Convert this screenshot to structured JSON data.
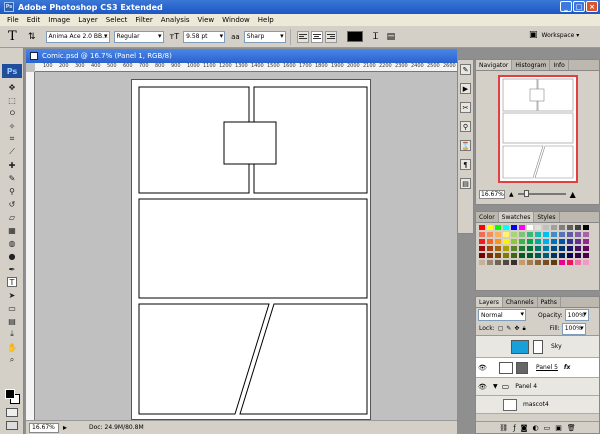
{
  "window": {
    "title": "Adobe Photoshop CS3 Extended",
    "app_icon": "Ps"
  },
  "menu": [
    "File",
    "Edit",
    "Image",
    "Layer",
    "Select",
    "Filter",
    "Analysis",
    "View",
    "Window",
    "Help"
  ],
  "options": {
    "font_family": "Anima Ace 2.0 BB...",
    "font_style": "Regular",
    "font_size": "9.58 pt",
    "anti_alias": "Sharp",
    "color": "#000000",
    "workspace_label": "Workspace ▾"
  },
  "toolbox": {
    "logo": "Ps"
  },
  "document": {
    "title": "Comic.psd @ 16.7% (Panel 1, RGB/8)",
    "zoom": "16.67%",
    "doc_size": "Doc: 24.9M/80.8M",
    "ruler_labels": [
      "100",
      "200",
      "300",
      "400",
      "500",
      "600",
      "700",
      "800",
      "900",
      "1000",
      "1100",
      "1200",
      "1300",
      "1400",
      "1500",
      "1600",
      "1700",
      "1800",
      "1900",
      "2000",
      "2100",
      "2200",
      "2300",
      "2400",
      "2500",
      "2600",
      "2700"
    ]
  },
  "navigator": {
    "tabs": [
      "Navigator",
      "Histogram",
      "Info"
    ],
    "zoom": "16.67%"
  },
  "swatches": {
    "tabs": [
      "Color",
      "Swatches",
      "Styles"
    ],
    "colors": [
      "#ff0000",
      "#ffff00",
      "#00ff00",
      "#00ffff",
      "#0000ff",
      "#ff00ff",
      "#ffffff",
      "#e0e0e0",
      "#c0c0c0",
      "#a0a0a0",
      "#808080",
      "#606060",
      "#404040",
      "#000000",
      "#f26c4f",
      "#f68e55",
      "#fbaf5c",
      "#fff467",
      "#acd372",
      "#7cc576",
      "#3bb878",
      "#1abbb4",
      "#00bff3",
      "#438ccb",
      "#5574b9",
      "#605ca8",
      "#855fa8",
      "#a763a9",
      "#ed1c24",
      "#f26522",
      "#f7941d",
      "#fff200",
      "#8dc63f",
      "#39b54a",
      "#00a651",
      "#00a99d",
      "#00aeef",
      "#0072bc",
      "#0054a6",
      "#2e3192",
      "#662d91",
      "#92278f",
      "#9e0b0f",
      "#a0410d",
      "#a36209",
      "#aba000",
      "#598527",
      "#1a7b30",
      "#007236",
      "#00746b",
      "#0076a3",
      "#004b80",
      "#003471",
      "#1b1464",
      "#440e62",
      "#630460",
      "#790000",
      "#7b2e00",
      "#7d4900",
      "#827b00",
      "#406618",
      "#005e20",
      "#005826",
      "#005952",
      "#005b7f",
      "#003663",
      "#002157",
      "#0d004c",
      "#32004b",
      "#4b0049",
      "#c7b299",
      "#998675",
      "#736357",
      "#534741",
      "#37302d",
      "#c69c6d",
      "#a67c52",
      "#8c6239",
      "#754c24",
      "#603913",
      "#ec008c",
      "#ed145b",
      "#f06eaa",
      "#f49ac2"
    ]
  },
  "layers": {
    "tabs": [
      "Layers",
      "Channels",
      "Paths"
    ],
    "blend_mode": "Normal",
    "opacity_label": "Opacity:",
    "opacity": "100%",
    "lock_label": "Lock:",
    "fill_label": "Fill:",
    "fill": "100%",
    "items": [
      {
        "name": "Sky",
        "thumb_color": "#1aa0d8"
      },
      {
        "name": "Panel 5",
        "fx": "fx"
      },
      {
        "name": "Panel 4"
      },
      {
        "name": "mascot4"
      }
    ]
  }
}
